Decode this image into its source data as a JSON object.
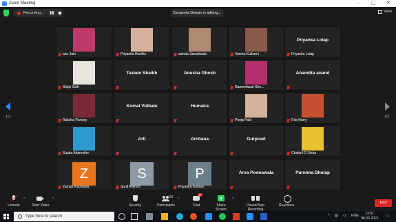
{
  "window": {
    "title": "Zoom Meeting",
    "controls": [
      "–",
      "▢",
      "✕"
    ]
  },
  "topbar": {
    "recording_label": "Recording...",
    "talking": "Sangeeta Dewan is talking...",
    "view_label": "View"
  },
  "gallery": {
    "page_left": "1/3",
    "page_right": "1/3",
    "tiles": [
      {
        "name": "anu Jain",
        "type": "photo",
        "color": "#c0396b"
      },
      {
        "name": "Priyanka Hurdhe",
        "type": "photo",
        "color": "#d8b0a0"
      },
      {
        "name": "zainab Jawadwala",
        "type": "photo",
        "color": "#b08a70"
      },
      {
        "name": "Varsha Kulkarni",
        "type": "photo",
        "color": "#8a5a4a"
      },
      {
        "name": "Priyanka Lolap",
        "type": "text",
        "big": "Priyanka Lolap"
      },
      {
        "name": "Shilpi Seth",
        "type": "photo",
        "color": "#e8e4de"
      },
      {
        "name": "",
        "type": "text",
        "big": "Tazeen Shaikh"
      },
      {
        "name": "",
        "type": "text",
        "big": "Anusha Ghosh"
      },
      {
        "name": "Rameshwari She...",
        "type": "photo",
        "color": "#b4306a"
      },
      {
        "name": "",
        "type": "text",
        "big": "Anandita anand"
      },
      {
        "name": "Raksha Pandey",
        "type": "photo",
        "color": "#7a2a34"
      },
      {
        "name": "",
        "type": "text",
        "big": "Komal Vidhate"
      },
      {
        "name": "",
        "type": "text",
        "big": "Humaira"
      },
      {
        "name": "Pooja Patil",
        "type": "photo",
        "color": "#d2b49c"
      },
      {
        "name": "Rita Harry",
        "type": "photo",
        "color": "#c85030"
      },
      {
        "name": "Sujata Adamuthe",
        "type": "photo",
        "color": "#2e9bd0"
      },
      {
        "name": "",
        "type": "text",
        "big": "Arti"
      },
      {
        "name": "",
        "type": "text",
        "big": "Archana"
      },
      {
        "name": "",
        "type": "text",
        "big": "Gurpreet"
      },
      {
        "name": "Chaitali G Sinha",
        "type": "photo",
        "color": "#e8c030"
      },
      {
        "name": "Zainab Kachwala",
        "type": "avatar",
        "letter": "Z",
        "color": "#e8761e"
      },
      {
        "name": "Sunil Rathod",
        "type": "avatar",
        "letter": "S",
        "color": "#8d9aa6"
      },
      {
        "name": "Priyanka Kumari",
        "type": "avatar",
        "letter": "P",
        "color": "#6e7f8c"
      },
      {
        "name": "",
        "type": "text",
        "big": "Arva Poonawala"
      },
      {
        "name": "",
        "type": "text",
        "big": "Purnima Dhulap"
      }
    ]
  },
  "toolbar": {
    "unmute": "Unmute",
    "start_video": "Start Video",
    "security": "Security",
    "participants": "Participants",
    "participants_count": "52",
    "chat": "Chat",
    "chat_badge": "17",
    "share_screen": "Share Screen",
    "pause_recording": "Pause/Stop Recording",
    "reactions": "Reactions",
    "end": "End"
  },
  "taskbar": {
    "search_placeholder": "Type here to search",
    "lang": "ENG",
    "time": "13:51",
    "date": "08-03-2021"
  }
}
